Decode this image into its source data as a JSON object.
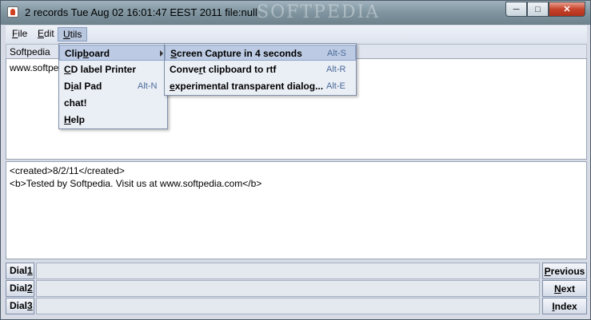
{
  "window": {
    "title": "2 records Tue Aug 02 16:01:47 EEST 2011 file:null",
    "bg_watermark": "SOFTPEDIA",
    "buttons": {
      "minimize": "─",
      "maximize": "□",
      "close": "✕"
    }
  },
  "menubar": {
    "file": {
      "first": "F",
      "rest": "ile"
    },
    "edit": {
      "first": "E",
      "rest": "dit"
    },
    "utils": {
      "first": "U",
      "rest": "tils"
    }
  },
  "top_label": "Softpedia",
  "top_area_text": "www.softpe",
  "bottom_area_lines": [
    "<created>8/2/11</created>",
    "<b>Tested by Softpedia. Visit us at www.softpedia.com</b>"
  ],
  "dials": [
    {
      "pre": "Dial",
      "num": "1"
    },
    {
      "pre": "Dial",
      "num": "2"
    },
    {
      "pre": "Dial",
      "num": "3"
    }
  ],
  "nav": {
    "previous": {
      "first": "P",
      "rest": "revious"
    },
    "next": {
      "first": "N",
      "rest": "ext"
    },
    "index": {
      "first": "I",
      "rest": "ndex"
    }
  },
  "utils_menu": {
    "items": [
      {
        "pre": "Clip",
        "u": "b",
        "post": "oard",
        "accel": ""
      },
      {
        "pre": "",
        "u": "C",
        "post": "D label Printer",
        "accel": ""
      },
      {
        "pre": "D",
        "u": "i",
        "post": "al Pad",
        "accel": "Alt-N"
      },
      {
        "pre": "chat!",
        "u": "",
        "post": "",
        "accel": ""
      },
      {
        "pre": "",
        "u": "H",
        "post": "elp",
        "accel": ""
      }
    ]
  },
  "clipboard_menu": {
    "items": [
      {
        "pre": "",
        "u": "S",
        "post": "creen Capture in 4 seconds",
        "accel": "Alt-S"
      },
      {
        "pre": "Conve",
        "u": "r",
        "post": "t clipboard to rtf",
        "accel": "Alt-R"
      },
      {
        "pre": "",
        "u": "e",
        "post": "xperimental transparent dialog...",
        "accel": "Alt-E"
      }
    ]
  },
  "colors": {
    "highlight": "#bccbe3",
    "accel": "#4a6a9a",
    "title_gradient": "#7f949f"
  }
}
